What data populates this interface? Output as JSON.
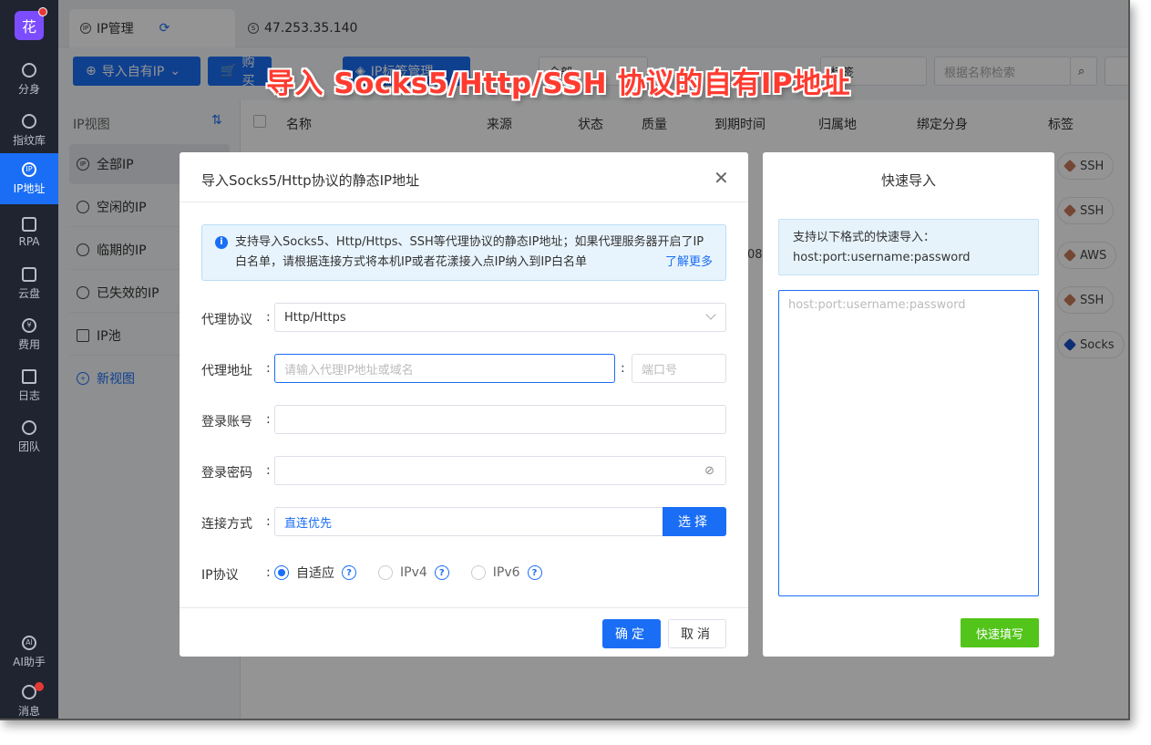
{
  "banner": "导入 Socks5/Http/SSH 协议的自有IP地址",
  "rail": {
    "logo": "花",
    "items": [
      {
        "label": "分身"
      },
      {
        "label": "指纹库"
      },
      {
        "label": "IP地址"
      },
      {
        "label": "RPA"
      },
      {
        "label": "云盘"
      },
      {
        "label": "费用"
      },
      {
        "label": "日志"
      },
      {
        "label": "团队"
      },
      {
        "label": "AI助手"
      },
      {
        "label": "消息"
      }
    ]
  },
  "tabs": [
    {
      "label": "IP管理"
    },
    {
      "label": "47.253.35.140"
    }
  ],
  "toolbar": {
    "import_label": "导入自有IP",
    "buy_label": "购买",
    "tag_manage_label": "IP标签管理",
    "filter_all": "全部",
    "tag_filter": "标签",
    "search_placeholder": "根据名称检索"
  },
  "view_panel": {
    "title": "IP视图",
    "items": [
      {
        "label": "全部IP"
      },
      {
        "label": "空闲的IP"
      },
      {
        "label": "临期的IP"
      },
      {
        "label": "已失效的IP"
      },
      {
        "label": "IP池"
      }
    ],
    "new_view": "新视图"
  },
  "table": {
    "columns": [
      "名称",
      "来源",
      "状态",
      "质量",
      "到期时间",
      "归属地",
      "绑定分身",
      "标签"
    ],
    "fragment": "08",
    "tags": [
      "SSH",
      "SSH",
      "AWS",
      "SSH",
      "Socks"
    ]
  },
  "dialog": {
    "title": "导入Socks5/Http协议的静态IP地址",
    "info_text": "支持导入Socks5、Http/Https、SSH等代理协议的静态IP地址；如果代理服务器开启了IP白名单，请根据连接方式将本机IP或者花漾接入点IP纳入到IP白名单",
    "info_link": "了解更多",
    "protocol_label": "代理协议",
    "protocol_value": "Http/Https",
    "address_label": "代理地址",
    "address_placeholder": "请输入代理IP地址或域名",
    "port_placeholder": "端口号",
    "account_label": "登录账号",
    "password_label": "登录密码",
    "connect_label": "连接方式",
    "connect_value": "直连优先",
    "select_btn": "选择",
    "ip_protocol_label": "IP协议",
    "ip_options": [
      "自适应",
      "IPv4",
      "IPv6"
    ],
    "ok": "确定",
    "cancel": "取消"
  },
  "quick": {
    "title": "快速导入",
    "info_line1": "支持以下格式的快速导入：",
    "info_line2": "host:port:username:password",
    "placeholder": "host:port:username:password",
    "button": "快速填写"
  },
  "colors": {
    "primary": "#1a6ef5",
    "success": "#52c41a",
    "banner": "#ff3b30",
    "rail": "#1f2430"
  }
}
